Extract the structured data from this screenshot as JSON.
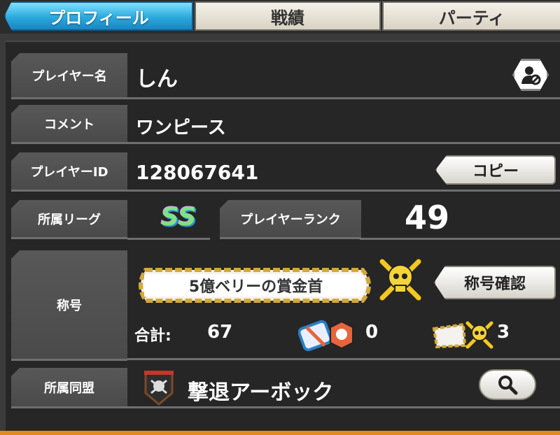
{
  "tabs": [
    {
      "label": "プロフィール",
      "active": true
    },
    {
      "label": "戦績",
      "active": false
    },
    {
      "label": "パーティ",
      "active": false
    }
  ],
  "profile": {
    "player_name_label": "プレイヤー名",
    "player_name": "しん",
    "comment_label": "コメント",
    "comment": "ワンピース",
    "player_id_label": "プレイヤーID",
    "player_id": "128067641",
    "copy_button": "コピー",
    "league_label": "所属リーグ",
    "league_badge": "SS",
    "rank_label": "プレイヤーランク",
    "rank": "49",
    "title_label": "称号",
    "title_name": "5億ベリーの賞金首",
    "title_confirm_button": "称号確認",
    "total_label": "合計:",
    "total_value": "67",
    "count_a": "0",
    "count_b": "3",
    "alliance_label": "所属同盟",
    "alliance_name": "撃退アーボック"
  },
  "colors": {
    "tab_active": "#2ba9dd",
    "badge_gold": "#f2c21a"
  }
}
